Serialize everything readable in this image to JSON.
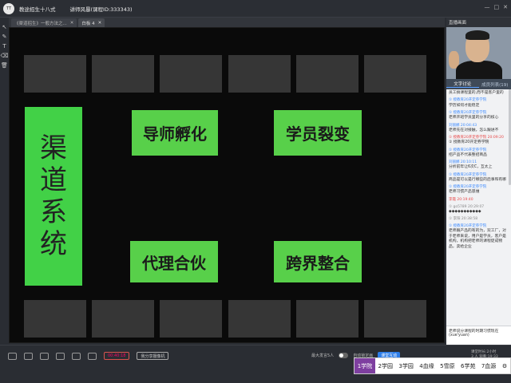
{
  "titlebar": {
    "app_title": "教途招生十八式",
    "room": "讲师风暴(课程ID:333343)",
    "controls": [
      "—",
      "□",
      "✕"
    ]
  },
  "tabs": [
    {
      "label": "《渠道招生》一般方法之...",
      "close": "✕"
    },
    {
      "label": "白板 4",
      "close": "✕"
    }
  ],
  "slide": {
    "vertical_title": [
      "渠",
      "道",
      "系",
      "统"
    ],
    "boxes": [
      "导师孵化",
      "学员裂变",
      "代理合伙",
      "跨界整合"
    ]
  },
  "right_panel": {
    "header": "直播画面",
    "chat_tabs": [
      "文字讨论",
      "成员列表(19)"
    ],
    "messages": [
      {
        "name": "",
        "text": "员工搞课程里的,而不是客户里的",
        "c": ""
      },
      {
        "name": "① 授教育20开定券学院",
        "text": "学历如何才能稳定",
        "c": ""
      },
      {
        "name": "① 授教育20开定券学院",
        "text": "老师开班学员里的分享的核心",
        "c": ""
      },
      {
        "name": "刘丽娜 20:04:43",
        "text": "老师先在对接触，怎么跟进不",
        "c": ""
      },
      {
        "name": "① 授教育20开定券学院 20:09:20",
        "text": "① 授教育20开定券学院",
        "c": "red"
      },
      {
        "name": "① 授教育20开定券学院",
        "text": "招产品不代表整招商品",
        "c": ""
      },
      {
        "name": "刘丽娜 20:10:11",
        "text": "分析前年让6次C，互太上",
        "c": ""
      },
      {
        "name": "① 授教育20开定券学院",
        "text": "商品是可以是行哪些的后事和有哪",
        "c": ""
      },
      {
        "name": "① 授教育20开定券学院",
        "text": "老师习惯产品思维",
        "c": ""
      },
      {
        "name": "李霞 20:19:40",
        "text": "",
        "c": "red"
      },
      {
        "name": "① go5789 20:29:07",
        "text": "◆◆◆◆◆◆◆◆◆◆◆",
        "c": "gray"
      },
      {
        "name": "① 李阳 20:38:58",
        "text": "",
        "c": "gray"
      },
      {
        "name": "① 授教育20开定券学院",
        "text": "老师跟产品的有的为，双工厂，对于老师来说，用户是学员，客户是机构，机构把老师的课程促成物品，卖给企业",
        "c": ""
      }
    ],
    "input_text": "老师说分课程的时期习惯现在(xue'yuan)"
  },
  "bottom": {
    "record_label": "00:40:18",
    "share_label": "我分享摄像机",
    "mic_label": "最大发言5人",
    "bg_label": "自动锁定画",
    "interact_label": "课堂互动",
    "right_text": [
      "课堂时长:2小时",
      "3 人 观看:19:33"
    ]
  },
  "ime": {
    "candidates": [
      "1学院",
      "2学园",
      "3学园",
      "4血缘",
      "5雪原",
      "6学苑",
      "7血源"
    ]
  }
}
